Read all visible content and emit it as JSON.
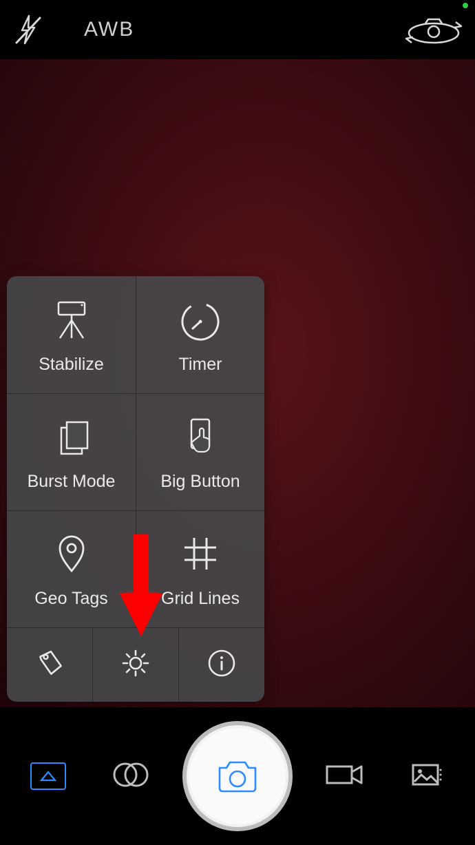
{
  "top_bar": {
    "awb_label": "AWB"
  },
  "panel": {
    "items": [
      {
        "label": "Stabilize",
        "icon": "tripod-icon"
      },
      {
        "label": "Timer",
        "icon": "timer-icon"
      },
      {
        "label": "Burst Mode",
        "icon": "burst-icon"
      },
      {
        "label": "Big Button",
        "icon": "finger-tap-icon"
      },
      {
        "label": "Geo Tags",
        "icon": "pin-icon"
      },
      {
        "label": "Grid Lines",
        "icon": "grid-hash-icon"
      }
    ],
    "mini": [
      {
        "icon": "tag-icon"
      },
      {
        "icon": "gear-icon"
      },
      {
        "icon": "info-icon"
      }
    ]
  },
  "bottom_bar": {
    "modes": [
      {
        "icon": "exposure-icon",
        "active": true
      },
      {
        "icon": "filter-overlap-icon"
      },
      {
        "icon": "video-icon"
      },
      {
        "icon": "gallery-icon"
      }
    ]
  },
  "colors": {
    "accent": "#2a8cff",
    "icon": "#e6e6e6",
    "panel_bg": "rgba(70,70,73,0.93)",
    "arrow": "#ff0000"
  }
}
